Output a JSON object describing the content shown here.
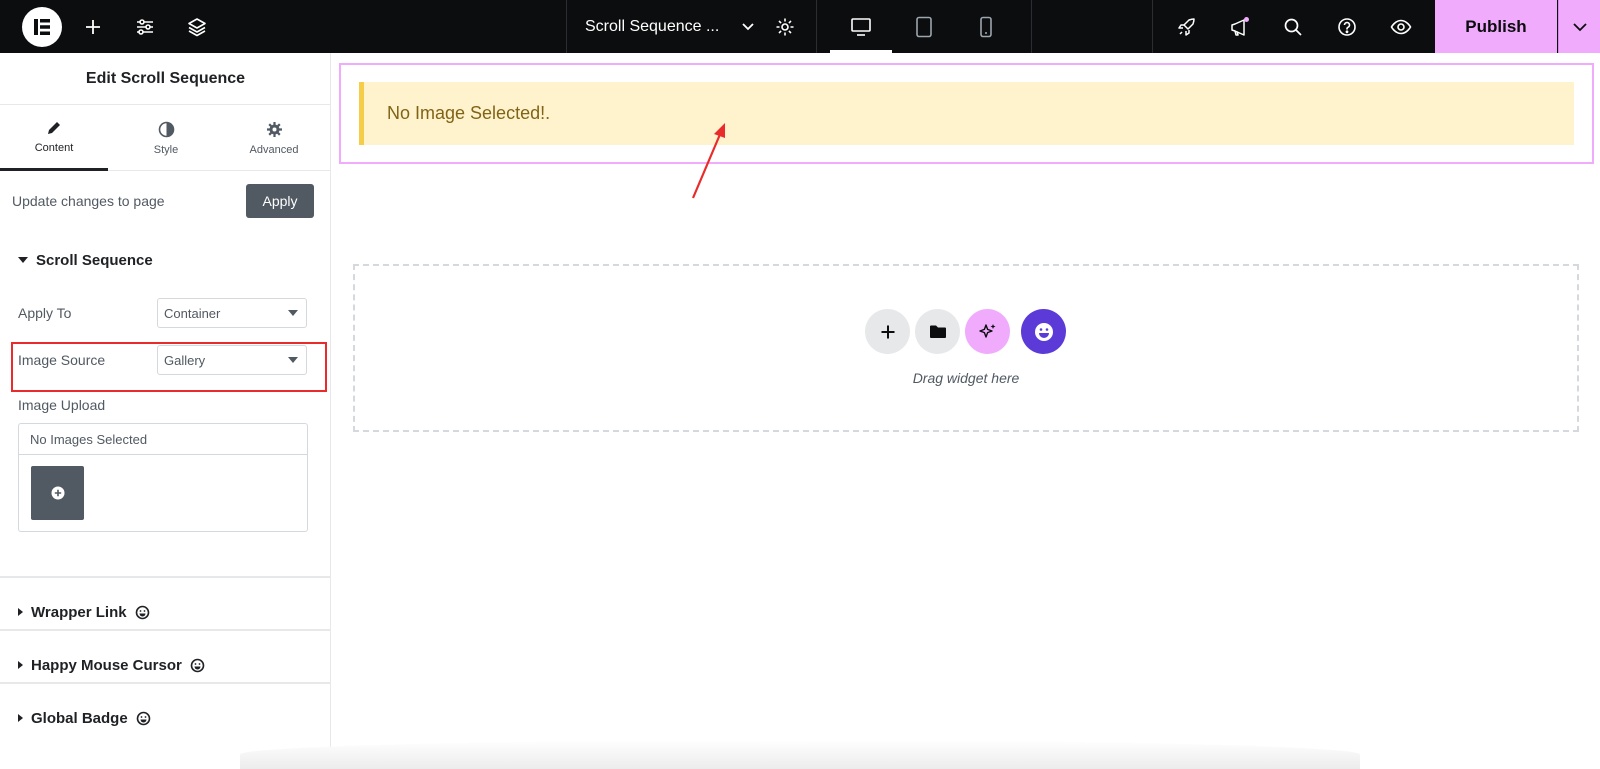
{
  "topbar": {
    "document_title": "Scroll Sequence ...",
    "publish_label": "Publish",
    "accent_color": "#f0abfc"
  },
  "panel": {
    "title": "Edit Scroll Sequence",
    "tabs": [
      {
        "label": "Content",
        "icon": "pencil-icon",
        "active": true
      },
      {
        "label": "Style",
        "icon": "contrast-icon",
        "active": false
      },
      {
        "label": "Advanced",
        "icon": "gear-icon",
        "active": false
      }
    ],
    "update_text": "Update changes to page",
    "apply_label": "Apply",
    "section_title": "Scroll Sequence",
    "apply_to": {
      "label": "Apply To",
      "value": "Container"
    },
    "image_source": {
      "label": "Image Source",
      "value": "Gallery"
    },
    "image_upload": {
      "label": "Image Upload",
      "status": "No Images Selected"
    },
    "collapsed_sections": [
      "Wrapper Link",
      "Happy Mouse Cursor",
      "Global Badge"
    ]
  },
  "canvas": {
    "notice_text": "No Image Selected!.",
    "drop_text": "Drag widget here"
  }
}
